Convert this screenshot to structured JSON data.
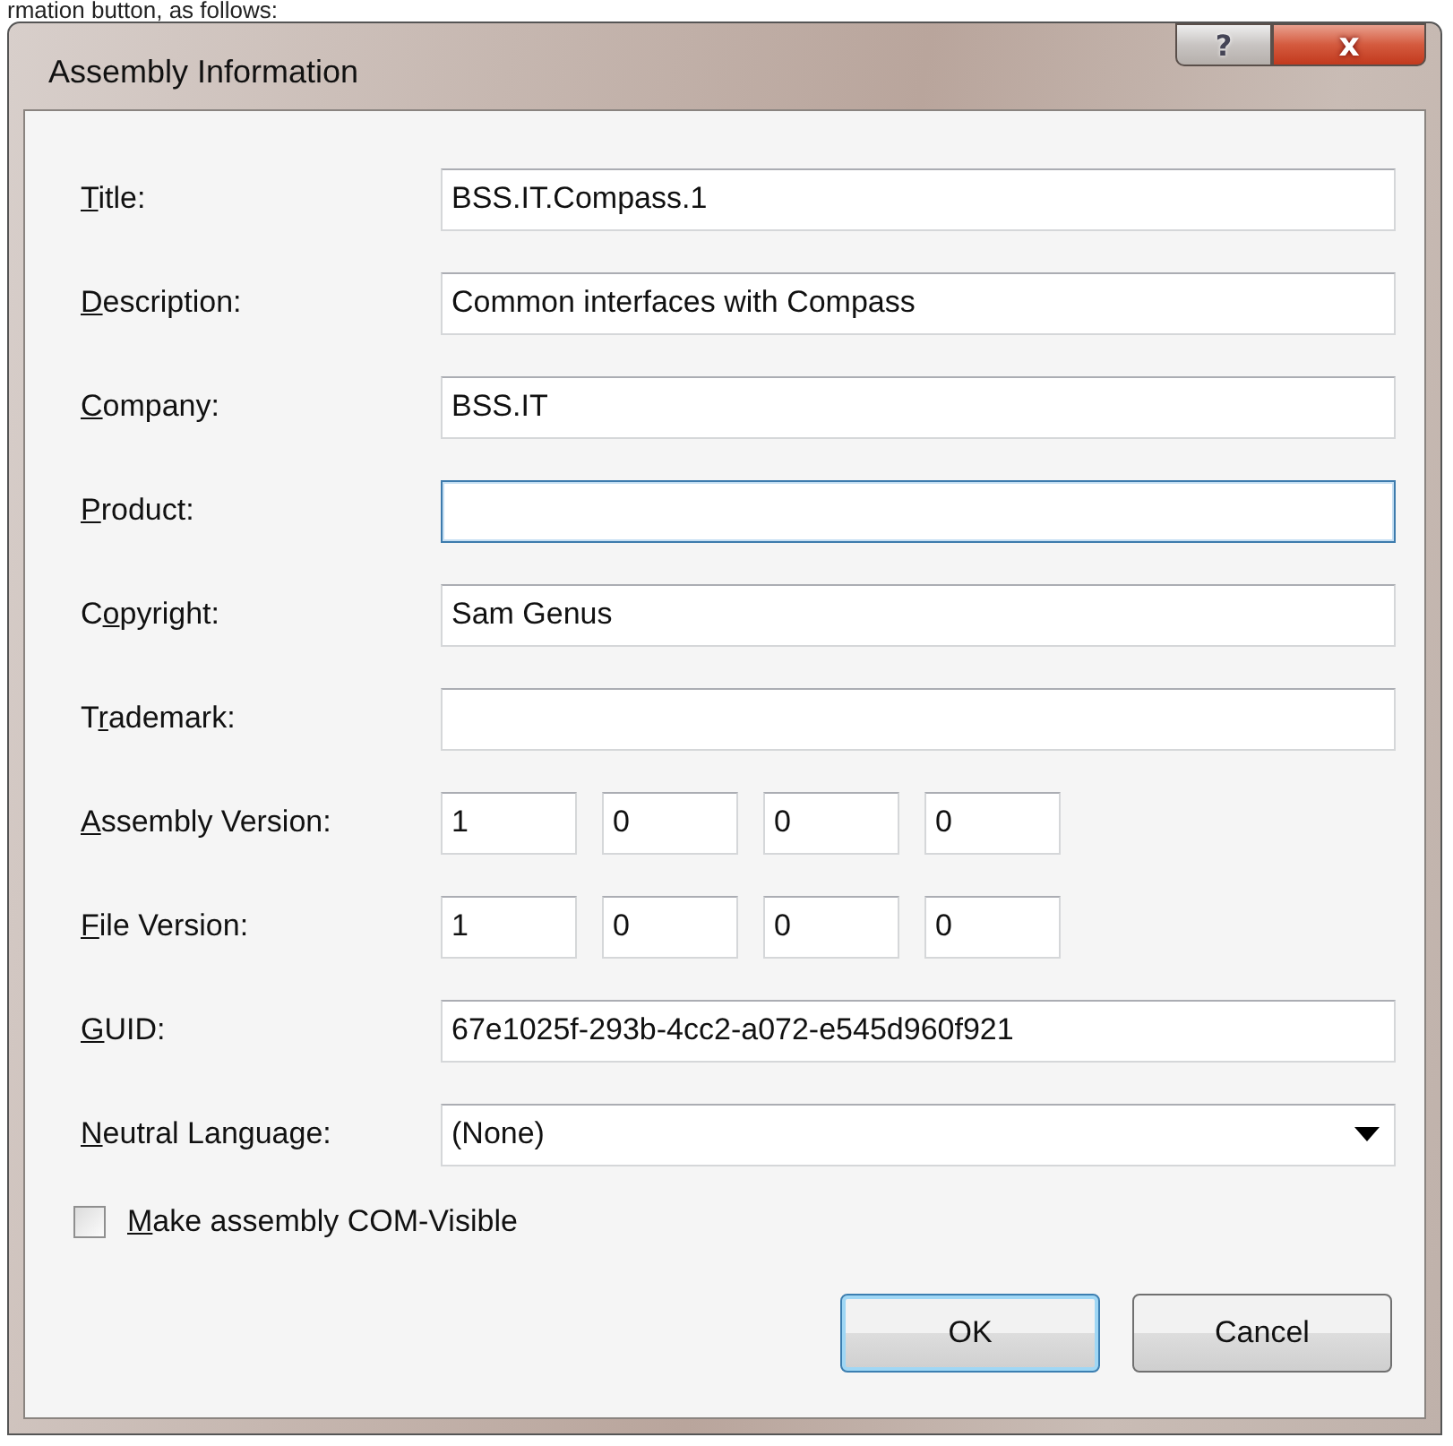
{
  "caption_above": "rmation button, as follows:",
  "window": {
    "title": "Assembly Information",
    "help_button": "?",
    "close_button": "x"
  },
  "fields": [
    {
      "kind": "text",
      "label": {
        "key": "T",
        "after": "itle:"
      },
      "value": "BSS.IT.Compass.1",
      "focused": false
    },
    {
      "kind": "text",
      "label": {
        "key": "D",
        "after": "escription:"
      },
      "value": "Common interfaces with Compass",
      "focused": false
    },
    {
      "kind": "text",
      "label": {
        "key": "C",
        "after": "ompany:"
      },
      "value": "BSS.IT",
      "focused": false
    },
    {
      "kind": "text",
      "label": {
        "key": "P",
        "after": "roduct:"
      },
      "focused": true
    },
    {
      "kind": "text",
      "label": {
        "before": "C",
        "key": "o",
        "after": "pyright:"
      },
      "value": "Sam Genus",
      "focused": false
    },
    {
      "kind": "text",
      "label": {
        "before": "T",
        "key": "r",
        "after": "ademark:"
      },
      "focused": false
    },
    {
      "kind": "version",
      "label": {
        "key": "A",
        "after": "ssembly Version:"
      },
      "values": [
        "1",
        "0",
        "0",
        "0"
      ]
    },
    {
      "kind": "version",
      "label": {
        "key": "F",
        "after": "ile Version:"
      },
      "values": [
        "1",
        "0",
        "0",
        "0"
      ]
    },
    {
      "kind": "text",
      "label": {
        "key": "G",
        "after": "UID:"
      },
      "value": "67e1025f-293b-4cc2-a072-e545d960f921",
      "focused": false
    },
    {
      "kind": "dropdown",
      "label": {
        "key": "N",
        "after": "eutral Language:"
      },
      "value": "(None)"
    }
  ],
  "checkbox": {
    "label": {
      "key": "M",
      "after": "ake assembly COM-Visible"
    },
    "checked": false
  },
  "buttons": [
    {
      "label": "OK",
      "default": true
    },
    {
      "label": "Cancel",
      "default": false
    }
  ]
}
